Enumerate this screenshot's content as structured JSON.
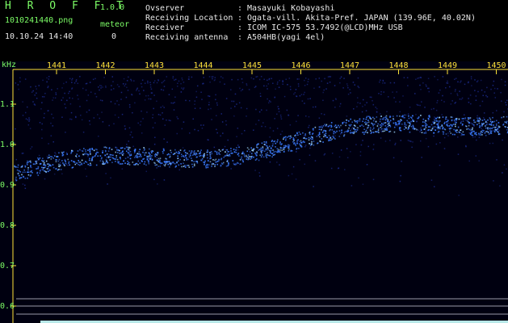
{
  "header": {
    "app_title": "H R O F F T",
    "app_version": "1.0.0",
    "filename": "1010241440.png",
    "meteor_label": "meteor",
    "datetime": "10.10.24 14:40",
    "meteor_count": "0",
    "info": [
      {
        "label": "Ovserver",
        "value": "Masayuki Kobayashi"
      },
      {
        "label": "Receiving Location",
        "value": "Ogata-vill. Akita-Pref. JAPAN (139.96E, 40.02N)"
      },
      {
        "label": "Receiver",
        "value": "ICOM IC-575 53.7492(@LCD)MHz USB"
      },
      {
        "label": "Receiving antenna",
        "value": "A504HB(yagi 4el)"
      }
    ]
  },
  "plot": {
    "y_unit": "kHz",
    "x_ticks": [
      "1441",
      "1442",
      "1443",
      "1444",
      "1445",
      "1446",
      "1447",
      "1448",
      "1449",
      "1450"
    ],
    "y_ticks": [
      "1.1",
      "1.0",
      "0.9",
      "0.8",
      "0.7",
      "0.6"
    ],
    "colors": {
      "background": "#000010",
      "signal": "#3a7bff",
      "signal_bright": "#9fd8ff",
      "axis": "#ffe23a",
      "text": "#7cfc66"
    }
  }
}
